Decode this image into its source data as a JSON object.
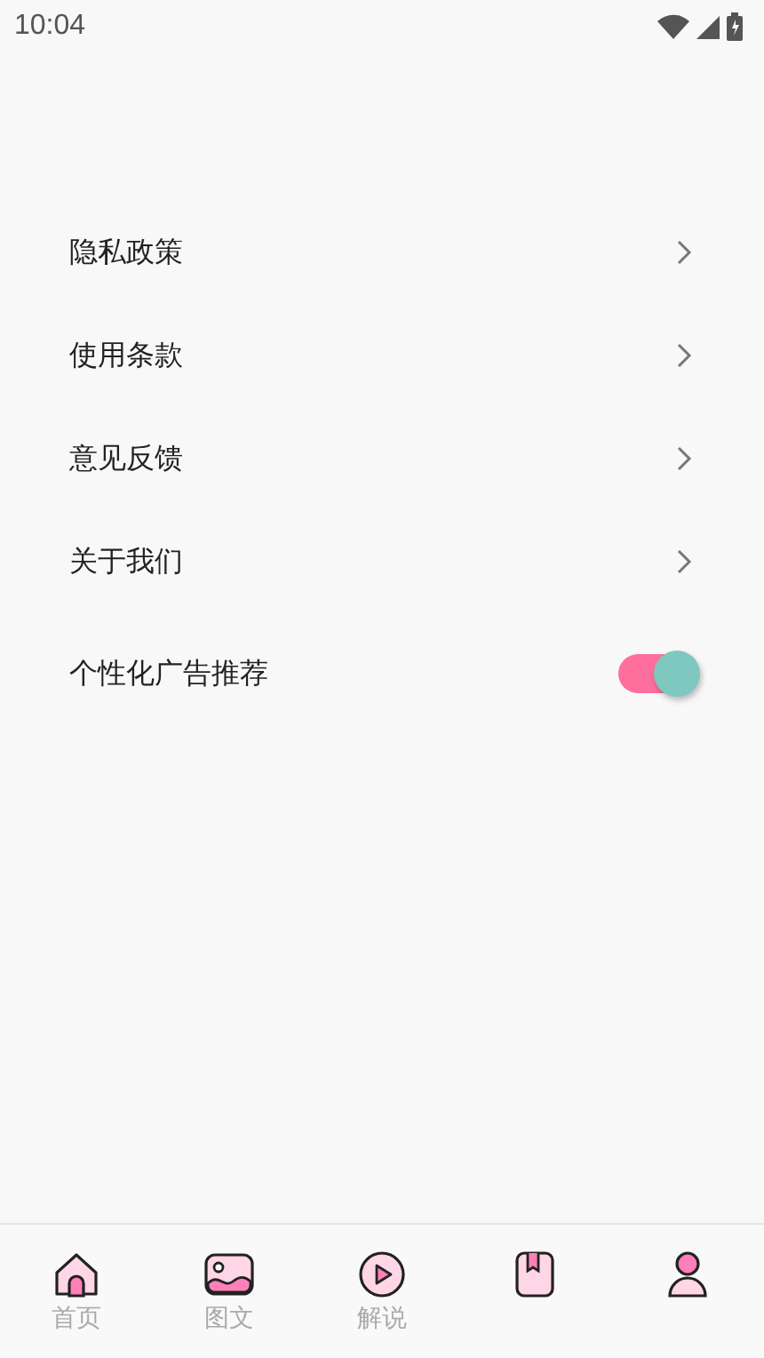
{
  "status_bar": {
    "time": "10:04"
  },
  "settings": [
    {
      "kind": "link",
      "label": "隐私政策"
    },
    {
      "kind": "link",
      "label": "使用条款"
    },
    {
      "kind": "link",
      "label": "意见反馈"
    },
    {
      "kind": "link",
      "label": "关于我们"
    },
    {
      "kind": "toggle",
      "label": "个性化广告推荐",
      "on": true
    }
  ],
  "bottom_nav": [
    {
      "kind": "home",
      "label": "首页"
    },
    {
      "kind": "image",
      "label": "图文"
    },
    {
      "kind": "play",
      "label": "解说"
    },
    {
      "kind": "book"
    },
    {
      "kind": "person"
    }
  ]
}
